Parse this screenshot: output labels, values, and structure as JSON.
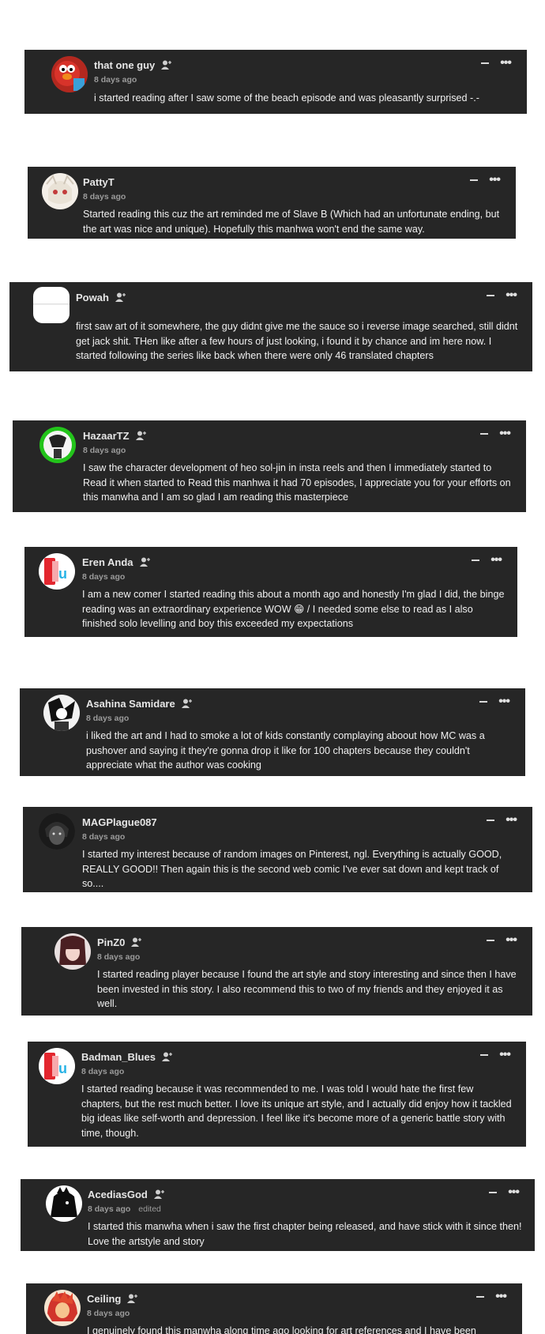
{
  "comments": [
    {
      "user": "that one guy",
      "time": "8 days ago",
      "text": "i started reading after I saw some of the beach episode and was pleasantly surprised -.-",
      "avatar": "elmo-avatar",
      "follow": true
    },
    {
      "user": "PattyT",
      "time": "8 days ago",
      "text": "Started reading this cuz the art reminded me of Slave B (Which had an unfortunate ending, but the art was nice and unique). Hopefully this manhwa won't end the same way.",
      "avatar": "girl-avatar",
      "follow": false
    },
    {
      "user": "Powah",
      "time": "",
      "text": "first saw art of it somewhere, the guy didnt give me the sauce so i reverse image searched, still didnt get jack shit. THen like after a few hours of just looking, i found it by chance and im here now. I started following the series like back when there were only 46 translated chapters",
      "avatar": "blank-avatar",
      "follow": true
    },
    {
      "user": "HazaarTZ",
      "time": "8 days ago",
      "text": "I saw the character development of heo sol-jin in insta reels and then I immediately started to Read it when started to Read this manhwa it had 70 episodes, I appreciate you for your efforts on this manwha and I am so glad I am reading this masterpiece",
      "avatar": "green-avatar",
      "follow": true
    },
    {
      "user": "Eren Anda",
      "time": "8 days ago",
      "text": "I am a new comer I started reading this about a month ago and honestly I'm glad I did, the binge reading was an extraordinary experience WOW 😁 / I needed some else to read as I also finished solo levelling and boy this exceeded my expectations",
      "avatar": "app-avatar",
      "follow": true
    },
    {
      "user": "Asahina Samidare",
      "time": "8 days ago",
      "text": "i liked the art and I had to smoke a lot of kids constantly complaying aboout how MC was a pushover and saying it they're gonna drop it like for 100 chapters because they couldn't appreciate what the author was cooking",
      "avatar": "manga-avatar",
      "follow": true
    },
    {
      "user": "MAGPlague087",
      "time": "8 days ago",
      "text": "I started my interest because of random images on Pinterest, ngl. Everything is actually GOOD, REALLY GOOD!! Then again this is the second web comic I've ever sat down and kept track of so....",
      "avatar": "dark-avatar",
      "follow": false
    },
    {
      "user": "PinZ0",
      "time": "8 days ago",
      "text": "I started reading player because I found the art style and story interesting and since then I have been invested in this story. I also recommend this to two of my friends and they enjoyed it as well.",
      "avatar": "anime-avatar",
      "follow": true
    },
    {
      "user": "Badman_Blues",
      "time": "8 days ago",
      "text": "I started reading because it was recommended to me. I was told I would hate the first few chapters, but the rest much better. I love its unique art style, and I actually did enjoy how it tackled big ideas like self-worth and depression. I feel like it's become more of a generic battle story with time, though.",
      "avatar": "app-avatar",
      "follow": true
    },
    {
      "user": "AcediasGod",
      "time": "8 days ago",
      "edited": "edited",
      "text": "I started this manwha when i saw the first chapter being released, and have stick with it since then! Love the artstyle and story",
      "avatar": "silhouette-avatar",
      "follow": true
    },
    {
      "user": "Ceiling",
      "time": "8 days ago",
      "text": "I genuinely found this manwha along time ago looking for art references and I have been",
      "avatar": "red-avatar",
      "follow": true
    }
  ]
}
